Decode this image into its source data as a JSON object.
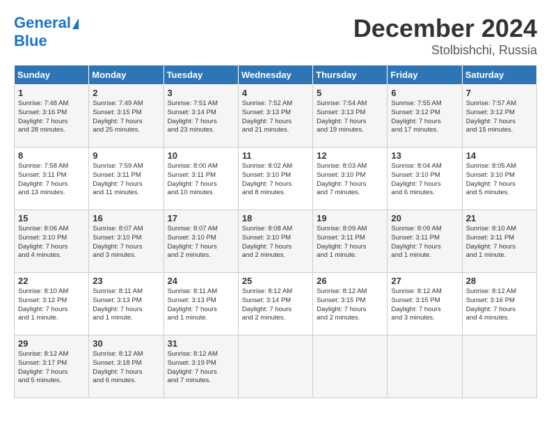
{
  "header": {
    "logo_line1": "General",
    "logo_line2": "Blue",
    "title": "December 2024",
    "subtitle": "Stolbishchi, Russia"
  },
  "weekdays": [
    "Sunday",
    "Monday",
    "Tuesday",
    "Wednesday",
    "Thursday",
    "Friday",
    "Saturday"
  ],
  "weeks": [
    [
      {
        "day": "1",
        "sunrise": "7:48 AM",
        "sunset": "3:16 PM",
        "daylight": "7 hours and 28 minutes."
      },
      {
        "day": "2",
        "sunrise": "7:49 AM",
        "sunset": "3:15 PM",
        "daylight": "7 hours and 25 minutes."
      },
      {
        "day": "3",
        "sunrise": "7:51 AM",
        "sunset": "3:14 PM",
        "daylight": "7 hours and 23 minutes."
      },
      {
        "day": "4",
        "sunrise": "7:52 AM",
        "sunset": "3:13 PM",
        "daylight": "7 hours and 21 minutes."
      },
      {
        "day": "5",
        "sunrise": "7:54 AM",
        "sunset": "3:13 PM",
        "daylight": "7 hours and 19 minutes."
      },
      {
        "day": "6",
        "sunrise": "7:55 AM",
        "sunset": "3:12 PM",
        "daylight": "7 hours and 17 minutes."
      },
      {
        "day": "7",
        "sunrise": "7:57 AM",
        "sunset": "3:12 PM",
        "daylight": "7 hours and 15 minutes."
      }
    ],
    [
      {
        "day": "8",
        "sunrise": "7:58 AM",
        "sunset": "3:11 PM",
        "daylight": "7 hours and 13 minutes."
      },
      {
        "day": "9",
        "sunrise": "7:59 AM",
        "sunset": "3:11 PM",
        "daylight": "7 hours and 11 minutes."
      },
      {
        "day": "10",
        "sunrise": "8:00 AM",
        "sunset": "3:11 PM",
        "daylight": "7 hours and 10 minutes."
      },
      {
        "day": "11",
        "sunrise": "8:02 AM",
        "sunset": "3:10 PM",
        "daylight": "7 hours and 8 minutes."
      },
      {
        "day": "12",
        "sunrise": "8:03 AM",
        "sunset": "3:10 PM",
        "daylight": "7 hours and 7 minutes."
      },
      {
        "day": "13",
        "sunrise": "8:04 AM",
        "sunset": "3:10 PM",
        "daylight": "7 hours and 6 minutes."
      },
      {
        "day": "14",
        "sunrise": "8:05 AM",
        "sunset": "3:10 PM",
        "daylight": "7 hours and 5 minutes."
      }
    ],
    [
      {
        "day": "15",
        "sunrise": "8:06 AM",
        "sunset": "3:10 PM",
        "daylight": "7 hours and 4 minutes."
      },
      {
        "day": "16",
        "sunrise": "8:07 AM",
        "sunset": "3:10 PM",
        "daylight": "7 hours and 3 minutes."
      },
      {
        "day": "17",
        "sunrise": "8:07 AM",
        "sunset": "3:10 PM",
        "daylight": "7 hours and 2 minutes."
      },
      {
        "day": "18",
        "sunrise": "8:08 AM",
        "sunset": "3:10 PM",
        "daylight": "7 hours and 2 minutes."
      },
      {
        "day": "19",
        "sunrise": "8:09 AM",
        "sunset": "3:11 PM",
        "daylight": "7 hours and 1 minute."
      },
      {
        "day": "20",
        "sunrise": "8:09 AM",
        "sunset": "3:11 PM",
        "daylight": "7 hours and 1 minute."
      },
      {
        "day": "21",
        "sunrise": "8:10 AM",
        "sunset": "3:11 PM",
        "daylight": "7 hours and 1 minute."
      }
    ],
    [
      {
        "day": "22",
        "sunrise": "8:10 AM",
        "sunset": "3:12 PM",
        "daylight": "7 hours and 1 minute."
      },
      {
        "day": "23",
        "sunrise": "8:11 AM",
        "sunset": "3:13 PM",
        "daylight": "7 hours and 1 minute."
      },
      {
        "day": "24",
        "sunrise": "8:11 AM",
        "sunset": "3:13 PM",
        "daylight": "7 hours and 1 minute."
      },
      {
        "day": "25",
        "sunrise": "8:12 AM",
        "sunset": "3:14 PM",
        "daylight": "7 hours and 2 minutes."
      },
      {
        "day": "26",
        "sunrise": "8:12 AM",
        "sunset": "3:15 PM",
        "daylight": "7 hours and 2 minutes."
      },
      {
        "day": "27",
        "sunrise": "8:12 AM",
        "sunset": "3:15 PM",
        "daylight": "7 hours and 3 minutes."
      },
      {
        "day": "28",
        "sunrise": "8:12 AM",
        "sunset": "3:16 PM",
        "daylight": "7 hours and 4 minutes."
      }
    ],
    [
      {
        "day": "29",
        "sunrise": "8:12 AM",
        "sunset": "3:17 PM",
        "daylight": "7 hours and 5 minutes."
      },
      {
        "day": "30",
        "sunrise": "8:12 AM",
        "sunset": "3:18 PM",
        "daylight": "7 hours and 6 minutes."
      },
      {
        "day": "31",
        "sunrise": "8:12 AM",
        "sunset": "3:19 PM",
        "daylight": "7 hours and 7 minutes."
      },
      null,
      null,
      null,
      null
    ]
  ]
}
